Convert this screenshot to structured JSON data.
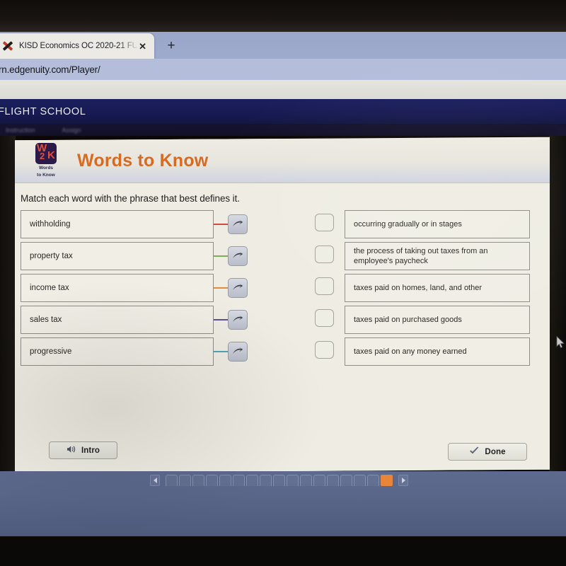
{
  "browser": {
    "tab": {
      "title": "KISD Economics OC 2020-21 FU",
      "favicon_name": "red-x-icon",
      "close_label": "✕"
    },
    "new_tab_label": "+",
    "url": "rn.edgenuity.com/Player/"
  },
  "site": {
    "brand": "FLIGHT SCHOOL",
    "subnav": [
      {
        "label": "Instruction"
      },
      {
        "label": "Assign"
      }
    ]
  },
  "lesson": {
    "logo": {
      "line1": "W",
      "line2": "2",
      "line3": "K",
      "caption_line1": "Words",
      "caption_line2": "to Know"
    },
    "title": "Words to Know",
    "prompt": "Match each word with the phrase that best defines it.",
    "terms": [
      {
        "label": "withholding",
        "connector_color": "#d9483e"
      },
      {
        "label": "property tax",
        "connector_color": "#7fae54"
      },
      {
        "label": "income tax",
        "connector_color": "#e08a3c"
      },
      {
        "label": "sales tax",
        "connector_color": "#5b4e9c"
      },
      {
        "label": "progressive",
        "connector_color": "#4fa5b8"
      }
    ],
    "definitions": [
      {
        "label": "occurring gradually or in stages"
      },
      {
        "label": "the process of taking out taxes from an employee's paycheck"
      },
      {
        "label": "taxes paid on homes, land, and other"
      },
      {
        "label": "taxes paid on purchased goods"
      },
      {
        "label": "taxes paid on any money earned"
      }
    ],
    "footer": {
      "intro_label": "Intro",
      "intro_icon": "speaker-icon",
      "done_label": "Done",
      "done_icon": "check-icon"
    }
  },
  "pager": {
    "prev_label": "◀",
    "next_label": "▶",
    "total_cells": 17,
    "active_index": 16,
    "active_color": "#e8853a"
  },
  "cursor": {
    "name": "mouse-pointer"
  }
}
